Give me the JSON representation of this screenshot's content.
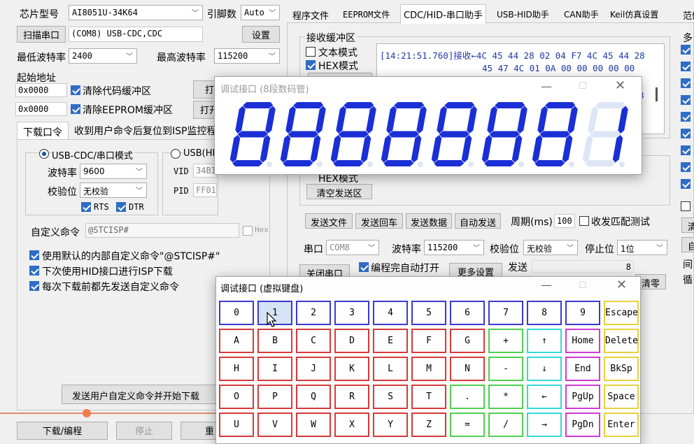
{
  "left": {
    "chip_label": "芯片型号",
    "chip_value": "AI8051U-34K64",
    "pin_label": "引脚数",
    "pin_value": "Auto",
    "scan_button": "扫描串口",
    "port_value": "(COM8) USB-CDC,CDC",
    "settings_button": "设置",
    "min_baud_label": "最低波特率",
    "min_baud_value": "2400",
    "max_baud_label": "最高波特率",
    "max_baud_value": "115200",
    "start_addr_label": "起始地址",
    "addr1": "0x0000",
    "clear_code_label": "清除代码缓冲区",
    "open_btn1": "打",
    "addr2": "0x0000",
    "clear_eeprom_label": "清除EEPROM缓冲区",
    "open_btn2": "打开",
    "tab_download": "下载口令",
    "tab_reset": "收到用户命令后复位到ISP监控程",
    "usb_cdc_mode": "USB-CDC/串口模式",
    "usb_hid_mode": "USB(HI",
    "baud_label": "波特率",
    "baud_value": "9600",
    "parity_label": "校验位",
    "parity_value": "无校验",
    "vid_label": "VID",
    "vid_value": "34BI",
    "pid_label": "PID",
    "pid_value": "FF01",
    "rts_label": "RTS",
    "dtr_label": "DTR",
    "custom_cmd_label": "自定义命令",
    "custom_cmd_value": "@STCISP#",
    "hex_label": "Hex",
    "opt1": "使用默认的内部自定义命令\"@STCISP#\"",
    "opt2": "下次使用HID接口进行ISP下载",
    "opt3": "每次下载前都先发送自定义命令",
    "send_custom_button": "发送用户自定义命令并开始下载",
    "download_button": "下载/编程",
    "stop_button": "停止",
    "re_button": "重"
  },
  "right": {
    "tabs": [
      "程序文件",
      "EEPROM文件",
      "CDC/HID-串口助手",
      "USB-HID助手",
      "CAN助手",
      "Keil仿真设置",
      "范例"
    ],
    "recv_buffer_label": "接收缓冲区",
    "text_mode": "文本模式",
    "hex_mode": "HEX模式",
    "clear_recv": "清空接收区",
    "recv_line1": "[14:21:51.760]接收←4C 45 44 28 02 04 F7 4C 45 44 28",
    "recv_line2": "45 47 4C 01 0A 00 00 00 00 00",
    "recv_digit": "8",
    "hex_mode2": "HEX模式",
    "clear_send": "清空发送区",
    "send_file": "发送文件",
    "send_back": "发送回车",
    "send_data": "发送数据",
    "auto_send": "自动发送",
    "period_label": "周期(ms)",
    "period_value": "100",
    "match_test": "收发匹配测试",
    "port_label": "串口",
    "port_value": "COM8",
    "baud_label": "波特率",
    "baud_value": "115200",
    "parity_label": "校验位",
    "parity_value": "无校验",
    "stopbit_label": "停止位",
    "stopbit_value": "1位",
    "close_port": "关闭串口",
    "auto_open": "编程完自动打开",
    "more_settings": "更多设置",
    "send_label": "发送",
    "send_count": "8",
    "clear_zero": "清零",
    "multi_label": "多",
    "side_qing": "清",
    "side_zi": "自",
    "side_jian": "间",
    "side_xun": "循"
  },
  "seg_window": {
    "title": "调试接口 (8段数码管)",
    "digits": [
      "8",
      "8",
      "8",
      "8",
      "8",
      "8",
      "8",
      "1"
    ],
    "lit_color": "#1a2fd6",
    "dim_color": "#dde6f6"
  },
  "kb_window": {
    "title": "调试接口 (虚拟键盘)",
    "rows": [
      [
        {
          "k": "0",
          "c": "k-blue"
        },
        {
          "k": "1",
          "c": "k-blue k-hover"
        },
        {
          "k": "2",
          "c": "k-blue"
        },
        {
          "k": "3",
          "c": "k-blue"
        },
        {
          "k": "4",
          "c": "k-blue"
        },
        {
          "k": "5",
          "c": "k-blue"
        },
        {
          "k": "6",
          "c": "k-blue"
        },
        {
          "k": "7",
          "c": "k-blue"
        },
        {
          "k": "8",
          "c": "k-blue"
        },
        {
          "k": "9",
          "c": "k-blue"
        },
        {
          "k": "Escape",
          "c": "k-yellow"
        }
      ],
      [
        {
          "k": "A",
          "c": "k-red"
        },
        {
          "k": "B",
          "c": "k-red"
        },
        {
          "k": "C",
          "c": "k-red"
        },
        {
          "k": "D",
          "c": "k-red"
        },
        {
          "k": "E",
          "c": "k-red"
        },
        {
          "k": "F",
          "c": "k-red"
        },
        {
          "k": "G",
          "c": "k-red"
        },
        {
          "k": "+",
          "c": "k-green"
        },
        {
          "k": "↑",
          "c": "k-cyan"
        },
        {
          "k": "Home",
          "c": "k-magenta"
        },
        {
          "k": "Delete",
          "c": "k-yellow"
        }
      ],
      [
        {
          "k": "H",
          "c": "k-red"
        },
        {
          "k": "I",
          "c": "k-red"
        },
        {
          "k": "J",
          "c": "k-red"
        },
        {
          "k": "K",
          "c": "k-red"
        },
        {
          "k": "L",
          "c": "k-red"
        },
        {
          "k": "M",
          "c": "k-red"
        },
        {
          "k": "N",
          "c": "k-red"
        },
        {
          "k": "-",
          "c": "k-green"
        },
        {
          "k": "↓",
          "c": "k-cyan"
        },
        {
          "k": "End",
          "c": "k-magenta"
        },
        {
          "k": "BkSp",
          "c": "k-yellow"
        }
      ],
      [
        {
          "k": "O",
          "c": "k-red"
        },
        {
          "k": "P",
          "c": "k-red"
        },
        {
          "k": "Q",
          "c": "k-red"
        },
        {
          "k": "R",
          "c": "k-red"
        },
        {
          "k": "S",
          "c": "k-red"
        },
        {
          "k": "T",
          "c": "k-red"
        },
        {
          "k": ".",
          "c": "k-green"
        },
        {
          "k": "*",
          "c": "k-green"
        },
        {
          "k": "←",
          "c": "k-cyan"
        },
        {
          "k": "PgUp",
          "c": "k-magenta"
        },
        {
          "k": "Space",
          "c": "k-yellow"
        }
      ],
      [
        {
          "k": "U",
          "c": "k-red"
        },
        {
          "k": "V",
          "c": "k-red"
        },
        {
          "k": "W",
          "c": "k-red"
        },
        {
          "k": "X",
          "c": "k-red"
        },
        {
          "k": "Y",
          "c": "k-red"
        },
        {
          "k": "Z",
          "c": "k-red"
        },
        {
          "k": "=",
          "c": "k-green"
        },
        {
          "k": "/",
          "c": "k-green"
        },
        {
          "k": "→",
          "c": "k-cyan"
        },
        {
          "k": "PgDn",
          "c": "k-magenta"
        },
        {
          "k": "Enter",
          "c": "k-yellow"
        }
      ]
    ]
  }
}
